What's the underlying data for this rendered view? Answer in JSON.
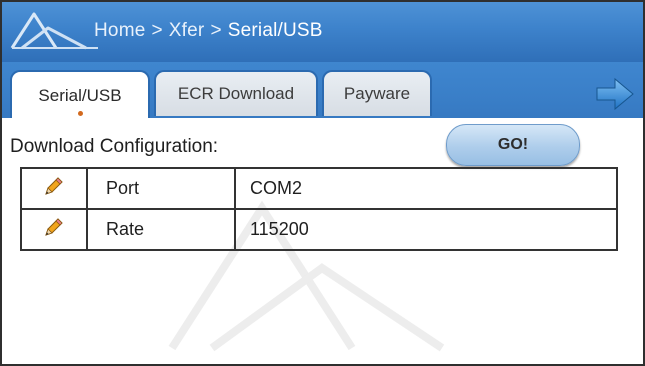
{
  "breadcrumb": {
    "items": [
      "Home",
      "Xfer",
      "Serial/USB"
    ],
    "separator": ">"
  },
  "tabs": [
    {
      "label": "Serial/USB",
      "active": true
    },
    {
      "label": "ECR Download",
      "active": false
    },
    {
      "label": "Payware",
      "active": false
    }
  ],
  "content": {
    "title": "Download Configuration:",
    "go_label": "GO!",
    "rows": [
      {
        "icon": "pencil-icon",
        "label": "Port",
        "value": "COM2"
      },
      {
        "icon": "pencil-icon",
        "label": "Rate",
        "value": "115200"
      }
    ]
  },
  "colors": {
    "header_blue": "#3d82cb",
    "tab_dot": "#d2691e",
    "arrow_blue": "#2e86d6"
  }
}
